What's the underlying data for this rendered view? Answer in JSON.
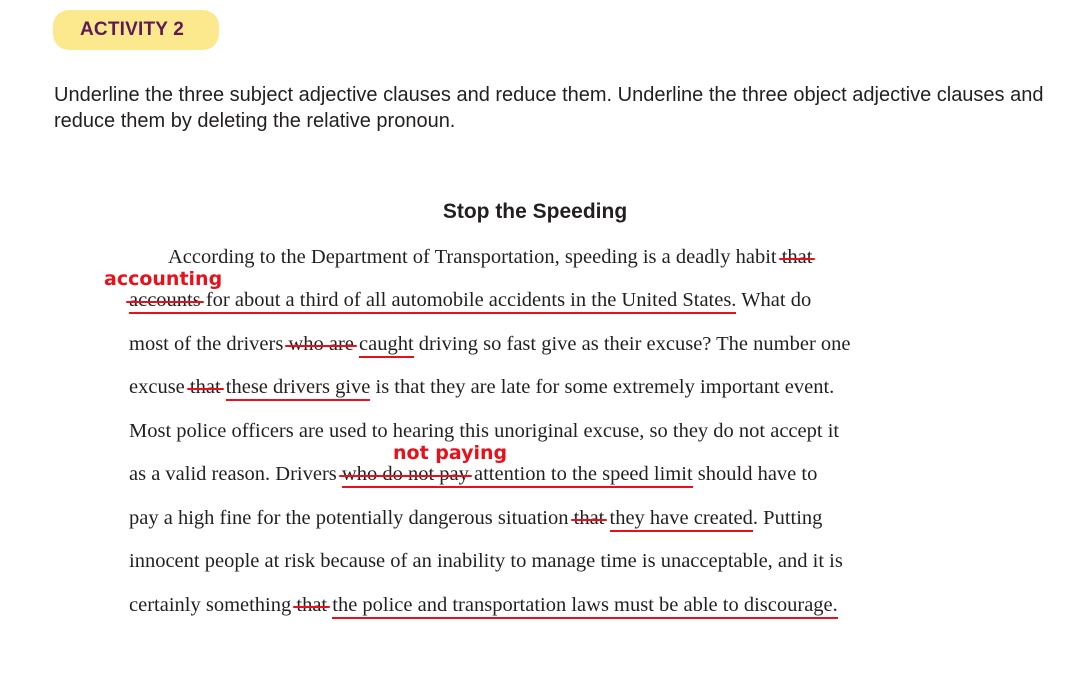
{
  "header": {
    "badge_label": "ACTIVITY 2"
  },
  "instructions": {
    "text": "Underline the three subject adjective clauses and reduce them. Underline the three object adjective clauses and reduce them by deleting the relative pronoun."
  },
  "passage": {
    "title": "Stop the Speeding",
    "annotations": {
      "accounting": "accounting",
      "not_paying": "not paying"
    },
    "line1": {
      "a": "According to the Department of Transportation, speeding is a deadly habit ",
      "strike": "that"
    },
    "line2": {
      "strike": "accounts",
      "u": " for about a third of all automobile accidents in the United States.",
      "b": " What do"
    },
    "line3": {
      "a": "most of the drivers ",
      "strike": "who are",
      "sp": " ",
      "u": "caught",
      "b": " driving so fast give as their excuse? The number one"
    },
    "line4": {
      "a": "excuse ",
      "strike": "that",
      "sp": " ",
      "u": "these drivers give",
      "b": " is that they are late for some extremely important event."
    },
    "line5": {
      "a": "Most police officers are used to hearing this unoriginal excuse, so they do not accept it"
    },
    "line6": {
      "a": "as a valid reason. Drivers ",
      "strike": "who do not pay",
      "u": " attention to the speed limit",
      "b": " should have to"
    },
    "line7": {
      "a": "pay a high fine for the potentially dangerous situation ",
      "strike": "that",
      "sp": " ",
      "u": "they have created",
      "b": ". Putting"
    },
    "line8": {
      "a": "innocent people at risk because of an inability to manage time is unacceptable, and it is"
    },
    "line9": {
      "a": "certainly something ",
      "strike": "that",
      "sp": " ",
      "u": "the police and transportation laws must be able to discourage."
    }
  },
  "colors": {
    "badge_bg": "#fde98d",
    "badge_text": "#5e1a55",
    "annotation_red": "#e8101a"
  }
}
